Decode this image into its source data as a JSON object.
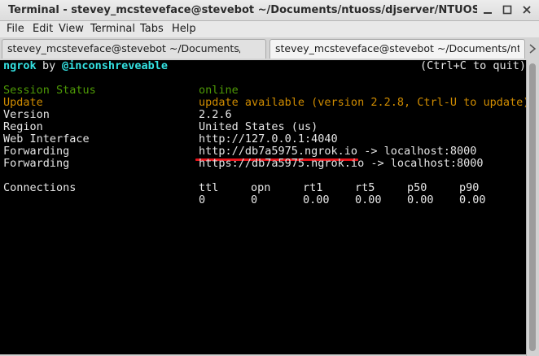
{
  "window": {
    "title": "Terminal - stevey_mcsteveface@stevebot ~/Documents/ntuoss/djserver/NTUOSS-DjangoWorkshop"
  },
  "menu": [
    "File",
    "Edit",
    "View",
    "Terminal",
    "Tabs",
    "Help"
  ],
  "tabs": [
    {
      "label": "stevey_mcsteveface@stevebot ~/Documents/ntuoss/djserver/NTUOSS-DjangoWorkshop",
      "active": false
    },
    {
      "label": "stevey_mcsteveface@stevebot ~/Documents/ntuoss/djserver/NTUOSS-DjangoWorkshop",
      "active": true
    }
  ],
  "terminal": {
    "header_app": "ngrok",
    "header_by": "by",
    "header_author": "@inconshreveable",
    "header_quit": "(Ctrl+C to quit)",
    "rows": {
      "session_status": {
        "key": "Session Status",
        "value": "online"
      },
      "update": {
        "key": "Update",
        "value": "update available (version 2.2.8, Ctrl-U to update)"
      },
      "version": {
        "key": "Version",
        "value": "2.2.6"
      },
      "region": {
        "key": "Region",
        "value": "United States (us)"
      },
      "web_interface": {
        "key": "Web Interface",
        "value": "http://127.0.0.1:4040"
      },
      "forwarding_http": {
        "key": "Forwarding",
        "value": "http://db7a5975.ngrok.io -> localhost:8000"
      },
      "forwarding_https": {
        "key": "Forwarding",
        "value": "https://db7a5975.ngrok.io -> localhost:8000"
      }
    },
    "connections": {
      "label": "Connections",
      "headers": [
        "ttl",
        "opn",
        "rt1",
        "rt5",
        "p50",
        "p90"
      ],
      "values": [
        "0",
        "0",
        "0.00",
        "0.00",
        "0.00",
        "0.00"
      ]
    }
  },
  "colors": {
    "terminal_bg": "#000000",
    "text": "#e6e6e6",
    "green": "#4e9a06",
    "orange": "#d08c00",
    "cyan": "#34e2e2",
    "annotation_red": "#e8141b"
  }
}
